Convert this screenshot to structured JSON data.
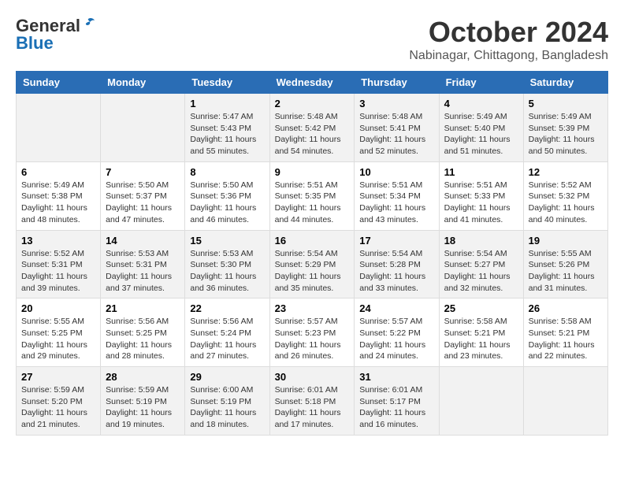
{
  "header": {
    "logo_line1": "General",
    "logo_line2": "Blue",
    "month": "October 2024",
    "location": "Nabinagar, Chittagong, Bangladesh"
  },
  "days_of_week": [
    "Sunday",
    "Monday",
    "Tuesday",
    "Wednesday",
    "Thursday",
    "Friday",
    "Saturday"
  ],
  "weeks": [
    [
      {
        "day": "",
        "content": ""
      },
      {
        "day": "",
        "content": ""
      },
      {
        "day": "1",
        "content": "Sunrise: 5:47 AM\nSunset: 5:43 PM\nDaylight: 11 hours and 55 minutes."
      },
      {
        "day": "2",
        "content": "Sunrise: 5:48 AM\nSunset: 5:42 PM\nDaylight: 11 hours and 54 minutes."
      },
      {
        "day": "3",
        "content": "Sunrise: 5:48 AM\nSunset: 5:41 PM\nDaylight: 11 hours and 52 minutes."
      },
      {
        "day": "4",
        "content": "Sunrise: 5:49 AM\nSunset: 5:40 PM\nDaylight: 11 hours and 51 minutes."
      },
      {
        "day": "5",
        "content": "Sunrise: 5:49 AM\nSunset: 5:39 PM\nDaylight: 11 hours and 50 minutes."
      }
    ],
    [
      {
        "day": "6",
        "content": "Sunrise: 5:49 AM\nSunset: 5:38 PM\nDaylight: 11 hours and 48 minutes."
      },
      {
        "day": "7",
        "content": "Sunrise: 5:50 AM\nSunset: 5:37 PM\nDaylight: 11 hours and 47 minutes."
      },
      {
        "day": "8",
        "content": "Sunrise: 5:50 AM\nSunset: 5:36 PM\nDaylight: 11 hours and 46 minutes."
      },
      {
        "day": "9",
        "content": "Sunrise: 5:51 AM\nSunset: 5:35 PM\nDaylight: 11 hours and 44 minutes."
      },
      {
        "day": "10",
        "content": "Sunrise: 5:51 AM\nSunset: 5:34 PM\nDaylight: 11 hours and 43 minutes."
      },
      {
        "day": "11",
        "content": "Sunrise: 5:51 AM\nSunset: 5:33 PM\nDaylight: 11 hours and 41 minutes."
      },
      {
        "day": "12",
        "content": "Sunrise: 5:52 AM\nSunset: 5:32 PM\nDaylight: 11 hours and 40 minutes."
      }
    ],
    [
      {
        "day": "13",
        "content": "Sunrise: 5:52 AM\nSunset: 5:31 PM\nDaylight: 11 hours and 39 minutes."
      },
      {
        "day": "14",
        "content": "Sunrise: 5:53 AM\nSunset: 5:31 PM\nDaylight: 11 hours and 37 minutes."
      },
      {
        "day": "15",
        "content": "Sunrise: 5:53 AM\nSunset: 5:30 PM\nDaylight: 11 hours and 36 minutes."
      },
      {
        "day": "16",
        "content": "Sunrise: 5:54 AM\nSunset: 5:29 PM\nDaylight: 11 hours and 35 minutes."
      },
      {
        "day": "17",
        "content": "Sunrise: 5:54 AM\nSunset: 5:28 PM\nDaylight: 11 hours and 33 minutes."
      },
      {
        "day": "18",
        "content": "Sunrise: 5:54 AM\nSunset: 5:27 PM\nDaylight: 11 hours and 32 minutes."
      },
      {
        "day": "19",
        "content": "Sunrise: 5:55 AM\nSunset: 5:26 PM\nDaylight: 11 hours and 31 minutes."
      }
    ],
    [
      {
        "day": "20",
        "content": "Sunrise: 5:55 AM\nSunset: 5:25 PM\nDaylight: 11 hours and 29 minutes."
      },
      {
        "day": "21",
        "content": "Sunrise: 5:56 AM\nSunset: 5:25 PM\nDaylight: 11 hours and 28 minutes."
      },
      {
        "day": "22",
        "content": "Sunrise: 5:56 AM\nSunset: 5:24 PM\nDaylight: 11 hours and 27 minutes."
      },
      {
        "day": "23",
        "content": "Sunrise: 5:57 AM\nSunset: 5:23 PM\nDaylight: 11 hours and 26 minutes."
      },
      {
        "day": "24",
        "content": "Sunrise: 5:57 AM\nSunset: 5:22 PM\nDaylight: 11 hours and 24 minutes."
      },
      {
        "day": "25",
        "content": "Sunrise: 5:58 AM\nSunset: 5:21 PM\nDaylight: 11 hours and 23 minutes."
      },
      {
        "day": "26",
        "content": "Sunrise: 5:58 AM\nSunset: 5:21 PM\nDaylight: 11 hours and 22 minutes."
      }
    ],
    [
      {
        "day": "27",
        "content": "Sunrise: 5:59 AM\nSunset: 5:20 PM\nDaylight: 11 hours and 21 minutes."
      },
      {
        "day": "28",
        "content": "Sunrise: 5:59 AM\nSunset: 5:19 PM\nDaylight: 11 hours and 19 minutes."
      },
      {
        "day": "29",
        "content": "Sunrise: 6:00 AM\nSunset: 5:19 PM\nDaylight: 11 hours and 18 minutes."
      },
      {
        "day": "30",
        "content": "Sunrise: 6:01 AM\nSunset: 5:18 PM\nDaylight: 11 hours and 17 minutes."
      },
      {
        "day": "31",
        "content": "Sunrise: 6:01 AM\nSunset: 5:17 PM\nDaylight: 11 hours and 16 minutes."
      },
      {
        "day": "",
        "content": ""
      },
      {
        "day": "",
        "content": ""
      }
    ]
  ]
}
